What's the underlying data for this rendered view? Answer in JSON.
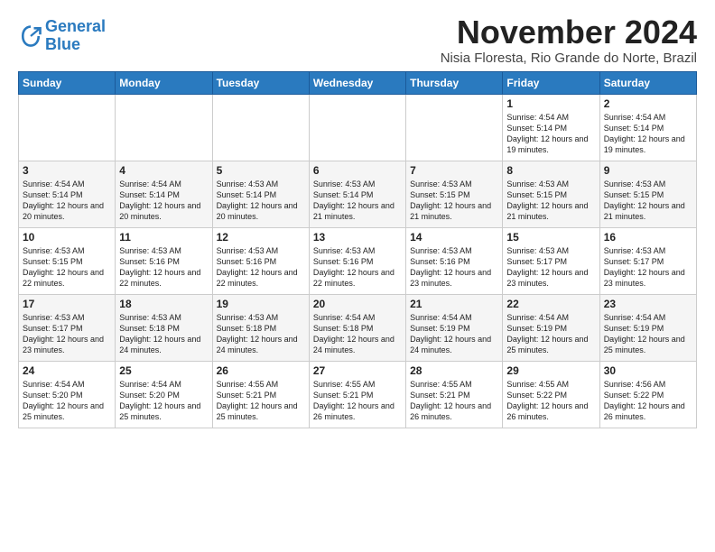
{
  "logo": {
    "line1": "General",
    "line2": "Blue"
  },
  "header": {
    "month": "November 2024",
    "location": "Nisia Floresta, Rio Grande do Norte, Brazil"
  },
  "weekdays": [
    "Sunday",
    "Monday",
    "Tuesday",
    "Wednesday",
    "Thursday",
    "Friday",
    "Saturday"
  ],
  "weeks": [
    [
      {
        "day": "",
        "detail": ""
      },
      {
        "day": "",
        "detail": ""
      },
      {
        "day": "",
        "detail": ""
      },
      {
        "day": "",
        "detail": ""
      },
      {
        "day": "",
        "detail": ""
      },
      {
        "day": "1",
        "detail": "Sunrise: 4:54 AM\nSunset: 5:14 PM\nDaylight: 12 hours\nand 19 minutes."
      },
      {
        "day": "2",
        "detail": "Sunrise: 4:54 AM\nSunset: 5:14 PM\nDaylight: 12 hours\nand 19 minutes."
      }
    ],
    [
      {
        "day": "3",
        "detail": "Sunrise: 4:54 AM\nSunset: 5:14 PM\nDaylight: 12 hours\nand 20 minutes."
      },
      {
        "day": "4",
        "detail": "Sunrise: 4:54 AM\nSunset: 5:14 PM\nDaylight: 12 hours\nand 20 minutes."
      },
      {
        "day": "5",
        "detail": "Sunrise: 4:53 AM\nSunset: 5:14 PM\nDaylight: 12 hours\nand 20 minutes."
      },
      {
        "day": "6",
        "detail": "Sunrise: 4:53 AM\nSunset: 5:14 PM\nDaylight: 12 hours\nand 21 minutes."
      },
      {
        "day": "7",
        "detail": "Sunrise: 4:53 AM\nSunset: 5:15 PM\nDaylight: 12 hours\nand 21 minutes."
      },
      {
        "day": "8",
        "detail": "Sunrise: 4:53 AM\nSunset: 5:15 PM\nDaylight: 12 hours\nand 21 minutes."
      },
      {
        "day": "9",
        "detail": "Sunrise: 4:53 AM\nSunset: 5:15 PM\nDaylight: 12 hours\nand 21 minutes."
      }
    ],
    [
      {
        "day": "10",
        "detail": "Sunrise: 4:53 AM\nSunset: 5:15 PM\nDaylight: 12 hours\nand 22 minutes."
      },
      {
        "day": "11",
        "detail": "Sunrise: 4:53 AM\nSunset: 5:16 PM\nDaylight: 12 hours\nand 22 minutes."
      },
      {
        "day": "12",
        "detail": "Sunrise: 4:53 AM\nSunset: 5:16 PM\nDaylight: 12 hours\nand 22 minutes."
      },
      {
        "day": "13",
        "detail": "Sunrise: 4:53 AM\nSunset: 5:16 PM\nDaylight: 12 hours\nand 22 minutes."
      },
      {
        "day": "14",
        "detail": "Sunrise: 4:53 AM\nSunset: 5:16 PM\nDaylight: 12 hours\nand 23 minutes."
      },
      {
        "day": "15",
        "detail": "Sunrise: 4:53 AM\nSunset: 5:17 PM\nDaylight: 12 hours\nand 23 minutes."
      },
      {
        "day": "16",
        "detail": "Sunrise: 4:53 AM\nSunset: 5:17 PM\nDaylight: 12 hours\nand 23 minutes."
      }
    ],
    [
      {
        "day": "17",
        "detail": "Sunrise: 4:53 AM\nSunset: 5:17 PM\nDaylight: 12 hours\nand 23 minutes."
      },
      {
        "day": "18",
        "detail": "Sunrise: 4:53 AM\nSunset: 5:18 PM\nDaylight: 12 hours\nand 24 minutes."
      },
      {
        "day": "19",
        "detail": "Sunrise: 4:53 AM\nSunset: 5:18 PM\nDaylight: 12 hours\nand 24 minutes."
      },
      {
        "day": "20",
        "detail": "Sunrise: 4:54 AM\nSunset: 5:18 PM\nDaylight: 12 hours\nand 24 minutes."
      },
      {
        "day": "21",
        "detail": "Sunrise: 4:54 AM\nSunset: 5:19 PM\nDaylight: 12 hours\nand 24 minutes."
      },
      {
        "day": "22",
        "detail": "Sunrise: 4:54 AM\nSunset: 5:19 PM\nDaylight: 12 hours\nand 25 minutes."
      },
      {
        "day": "23",
        "detail": "Sunrise: 4:54 AM\nSunset: 5:19 PM\nDaylight: 12 hours\nand 25 minutes."
      }
    ],
    [
      {
        "day": "24",
        "detail": "Sunrise: 4:54 AM\nSunset: 5:20 PM\nDaylight: 12 hours\nand 25 minutes."
      },
      {
        "day": "25",
        "detail": "Sunrise: 4:54 AM\nSunset: 5:20 PM\nDaylight: 12 hours\nand 25 minutes."
      },
      {
        "day": "26",
        "detail": "Sunrise: 4:55 AM\nSunset: 5:21 PM\nDaylight: 12 hours\nand 25 minutes."
      },
      {
        "day": "27",
        "detail": "Sunrise: 4:55 AM\nSunset: 5:21 PM\nDaylight: 12 hours\nand 26 minutes."
      },
      {
        "day": "28",
        "detail": "Sunrise: 4:55 AM\nSunset: 5:21 PM\nDaylight: 12 hours\nand 26 minutes."
      },
      {
        "day": "29",
        "detail": "Sunrise: 4:55 AM\nSunset: 5:22 PM\nDaylight: 12 hours\nand 26 minutes."
      },
      {
        "day": "30",
        "detail": "Sunrise: 4:56 AM\nSunset: 5:22 PM\nDaylight: 12 hours\nand 26 minutes."
      }
    ]
  ]
}
